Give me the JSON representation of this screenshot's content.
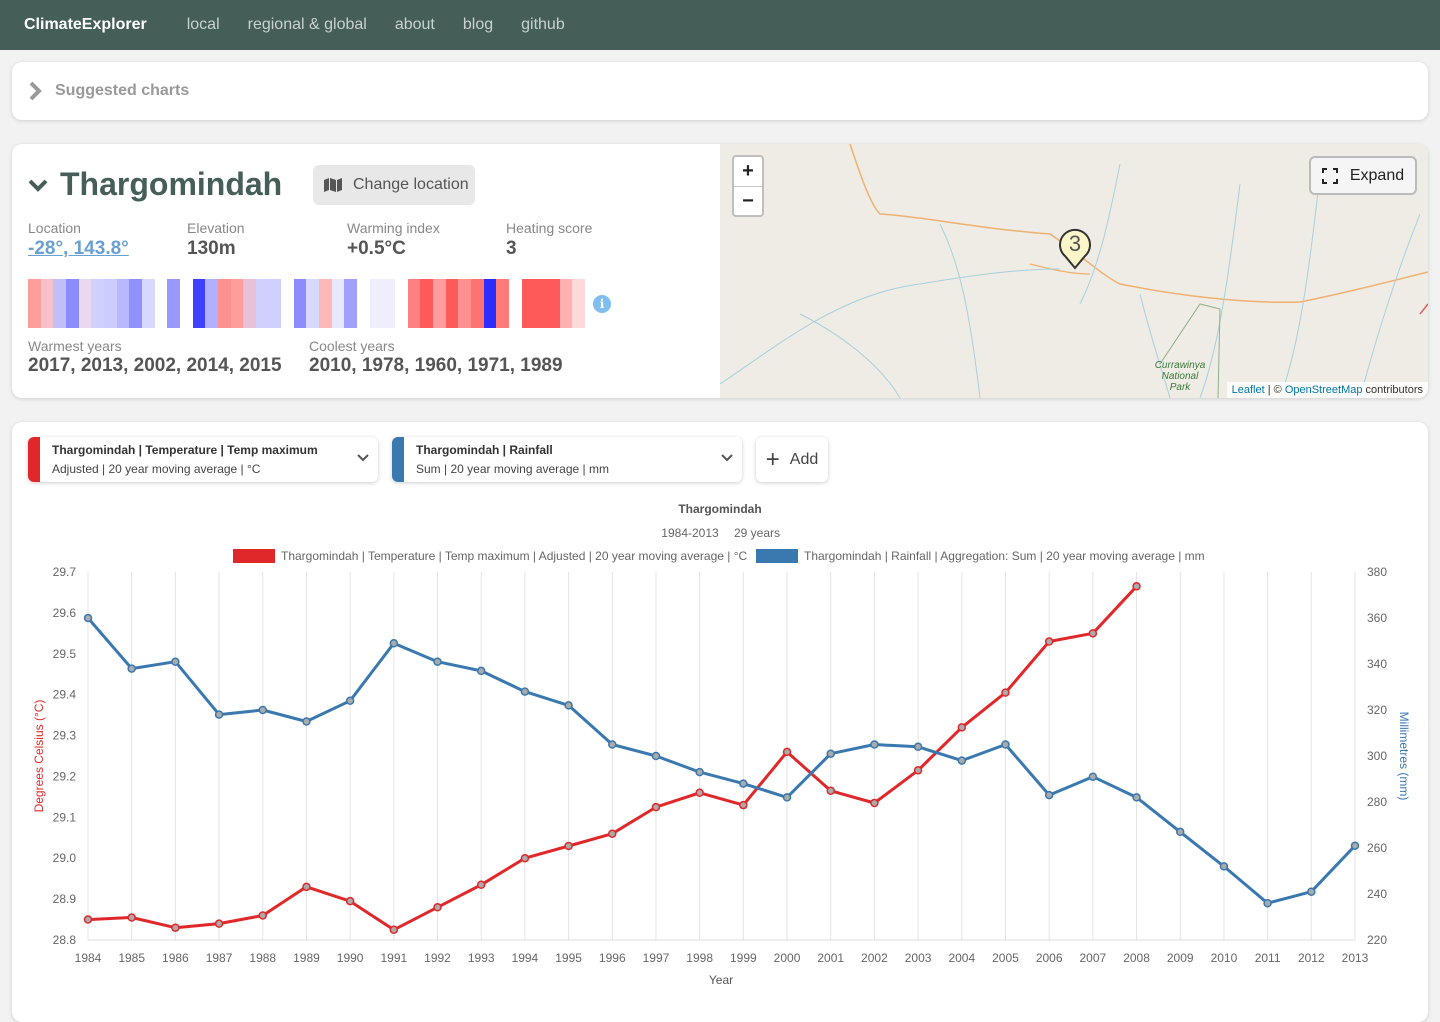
{
  "nav": {
    "brand": "ClimateExplorer",
    "links": [
      "local",
      "regional & global",
      "about",
      "blog",
      "github"
    ]
  },
  "suggested": {
    "label": "Suggested charts"
  },
  "location": {
    "title": "Thargomindah",
    "change_label": "Change location",
    "stats": [
      {
        "key": "Location",
        "value": "-28°, 143.8°"
      },
      {
        "key": "Elevation",
        "value": "130m"
      },
      {
        "key": "Warming index",
        "value": "+0.5°C"
      },
      {
        "key": "Heating score",
        "value": "3"
      }
    ],
    "warmest_label": "Warmest years",
    "warmest_value": "2017, 2013, 2002, 2014, 2015",
    "coolest_label": "Coolest years",
    "coolest_value": "2010, 1978, 1960, 1971, 1989",
    "stripe_colors": [
      "#ff9c9c",
      "#f8c0c8",
      "#c0c0f8",
      "#8c8cff",
      "#e8d8f0",
      "#d0d0fc",
      "#ccccff",
      "#b8b8ff",
      "#9090ff",
      "#d8d8fc",
      "#ffffff",
      "#9898ff",
      "#ffffff",
      "#4040ff",
      "#b0b0ff",
      "#ff9090",
      "#ff9c9c",
      "#e8c0d8",
      "#d0d0fc",
      "#d0d0fc",
      "#ffffff",
      "#8c8cff",
      "#d8d8fc",
      "#ffb8b8",
      "#e8e8fc",
      "#a0a0ff",
      "#ffffff",
      "#eeeefc",
      "#eeeefc",
      "#ffffff",
      "#ff8080",
      "#ff5a5a",
      "#ff9c9c",
      "#ff5a5a",
      "#ff9090",
      "#ff7272",
      "#2c2cff",
      "#ff7a7a",
      "#ffffff",
      "#ff5a5a",
      "#ff5a5a",
      "#ff5a5a",
      "#ffb0b0",
      "#ffd8d8"
    ]
  },
  "map": {
    "zoom_in": "+",
    "zoom_out": "−",
    "expand_label": "Expand",
    "marker_label": "3",
    "park_label_1": "Currawinya",
    "park_label_2": "National",
    "park_label_3": "Park",
    "attribution_leaflet": "Leaflet",
    "attribution_sep": " | © ",
    "attribution_osm": "OpenStreetMap",
    "attribution_suffix": " contributors"
  },
  "series_selectors": [
    {
      "line1": "Thargomindah | Temperature | Temp maximum",
      "line2": "Adjusted | 20 year moving average | °C",
      "color": "#e0282a"
    },
    {
      "line1": "Thargomindah | Rainfall",
      "line2": "Sum | 20 year moving average | mm",
      "color": "#3a78b0"
    }
  ],
  "add_label": "Add",
  "chart_data": {
    "type": "line",
    "title": "Thargomindah",
    "subtitle_range": "1984-2013",
    "subtitle_years": "29 years",
    "xlabel": "Year",
    "x": [
      1984,
      1985,
      1986,
      1987,
      1988,
      1989,
      1990,
      1991,
      1992,
      1993,
      1994,
      1995,
      1996,
      1997,
      1998,
      1999,
      2000,
      2001,
      2002,
      2003,
      2004,
      2005,
      2006,
      2007,
      2008,
      2009,
      2010,
      2011,
      2012,
      2013
    ],
    "series": [
      {
        "name": "Thargomindah | Temperature | Temp maximum | Adjusted | 20 year moving average | °C",
        "axis": "left",
        "color": "#e0282a",
        "values": [
          28.85,
          28.855,
          28.83,
          28.84,
          28.86,
          28.93,
          28.895,
          28.825,
          28.88,
          28.935,
          29.0,
          29.03,
          29.06,
          29.125,
          29.16,
          29.13,
          29.26,
          29.165,
          29.135,
          29.215,
          29.32,
          29.405,
          29.53,
          29.55,
          29.665,
          null,
          null,
          null,
          null,
          null
        ]
      },
      {
        "name": "Thargomindah | Rainfall | Aggregation: Sum | 20 year moving average | mm",
        "axis": "right",
        "color": "#3a78b0",
        "values": [
          360,
          338,
          341,
          318,
          320,
          315,
          324,
          349,
          341,
          337,
          328,
          322,
          305,
          300,
          293,
          288,
          282,
          301,
          305,
          304,
          298,
          305,
          283,
          291,
          282,
          267,
          252,
          236,
          241,
          261
        ]
      }
    ],
    "y_left": {
      "label": "Degrees Celsius (°C)",
      "min": 28.8,
      "max": 29.7,
      "ticks": [
        "29.7",
        "29.6",
        "29.5",
        "29.4",
        "29.3",
        "29.2",
        "29.1",
        "29.0",
        "28.9",
        "28.8"
      ]
    },
    "y_right": {
      "label": "Millimetres (mm)",
      "min": 220,
      "max": 380,
      "ticks": [
        "380",
        "360",
        "340",
        "320",
        "300",
        "280",
        "260",
        "240",
        "220"
      ]
    },
    "grid": "vertical",
    "legend": "top-center"
  }
}
